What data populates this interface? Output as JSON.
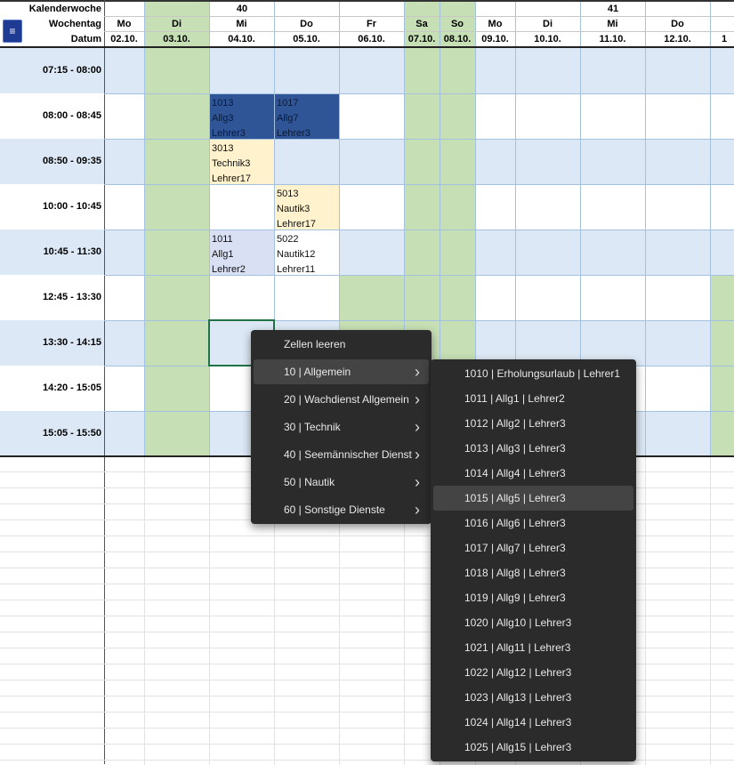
{
  "colors": {
    "timeslot_band": "#dce8f5",
    "weekend_fill": "#c6dfb4",
    "entry_dark": "#2f5597",
    "entry_cream": "#fff2cc",
    "entry_lavender": "#dae0f3",
    "grid_line": "#a4c2e0",
    "menu_bg": "#2b2b2b",
    "menu_highlight": "#444444",
    "menu_button": "#1f3a93"
  },
  "header": {
    "labels": {
      "week": "Kalenderwoche",
      "weekday": "Wochentag",
      "date": "Datum"
    },
    "weeks": [
      {
        "number": "40"
      },
      {
        "number": "41"
      }
    ],
    "menu_button_icon": "hamburger-menu-icon",
    "days": [
      {
        "weekday": "Mo",
        "date": "02.10."
      },
      {
        "weekday": "Di",
        "date": "03.10."
      },
      {
        "weekday": "Mi",
        "date": "04.10."
      },
      {
        "weekday": "Do",
        "date": "05.10."
      },
      {
        "weekday": "Fr",
        "date": "06.10."
      },
      {
        "weekday": "Sa",
        "date": "07.10."
      },
      {
        "weekday": "So",
        "date": "08.10."
      },
      {
        "weekday": "Mo",
        "date": "09.10."
      },
      {
        "weekday": "Di",
        "date": "10.10."
      },
      {
        "weekday": "Mi",
        "date": "11.10."
      },
      {
        "weekday": "Do",
        "date": "12.10."
      },
      {
        "weekday": "",
        "date": "1"
      }
    ]
  },
  "timeslots": [
    "07:15 - 08:00",
    "08:00 - 08:45",
    "08:50 - 09:35",
    "10:00 - 10:45",
    "10:45 - 11:30",
    "12:45 - 13:30",
    "13:30 - 14:15",
    "14:20 - 15:05",
    "15:05 - 15:50"
  ],
  "entries": [
    {
      "day": 2,
      "slot": 1,
      "style": "dark",
      "code": "1013",
      "subject": "Allg3",
      "teacher": "Lehrer3"
    },
    {
      "day": 3,
      "slot": 1,
      "style": "dark",
      "code": "1017",
      "subject": "Allg7",
      "teacher": "Lehrer3"
    },
    {
      "day": 2,
      "slot": 2,
      "style": "cream",
      "code": "3013",
      "subject": "Technik3",
      "teacher": "Lehrer17"
    },
    {
      "day": 3,
      "slot": 3,
      "style": "cream",
      "code": "5013",
      "subject": "Nautik3",
      "teacher": "Lehrer17"
    },
    {
      "day": 2,
      "slot": 4,
      "style": "lavender",
      "code": "1011",
      "subject": "Allg1",
      "teacher": "Lehrer2"
    },
    {
      "day": 3,
      "slot": 4,
      "style": "white",
      "code": "5022",
      "subject": "Nautik12",
      "teacher": "Lehrer11"
    }
  ],
  "context_menu": {
    "items": [
      {
        "label": "Zellen leeren",
        "submenu": false
      },
      {
        "label": "10 | Allgemein",
        "submenu": true,
        "active": true
      },
      {
        "label": "20 | Wachdienst Allgemein",
        "submenu": true
      },
      {
        "label": "30 | Technik",
        "submenu": true
      },
      {
        "label": "40 | Seemännischer Dienst",
        "submenu": true
      },
      {
        "label": "50 | Nautik",
        "submenu": true
      },
      {
        "label": "60 | Sonstige Dienste",
        "submenu": true
      }
    ],
    "submenu_items": [
      "1010 | Erholungsurlaub | Lehrer1",
      "1011 | Allg1 | Lehrer2",
      "1012 | Allg2 | Lehrer3",
      "1013 | Allg3 | Lehrer3",
      "1014 | Allg4 | Lehrer3",
      "1015 | Allg5 | Lehrer3",
      "1016 | Allg6 | Lehrer3",
      "1017 | Allg7 | Lehrer3",
      "1018 | Allg8 | Lehrer3",
      "1019 | Allg9 | Lehrer3",
      "1020 | Allg10 | Lehrer3",
      "1021 | Allg11 | Lehrer3",
      "1022 | Allg12 | Lehrer3",
      "1023 | Allg13 | Lehrer3",
      "1024 | Allg14 | Lehrer3",
      "1025 | Allg15 | Lehrer3"
    ],
    "submenu_highlight_index": 5,
    "chevron_icon": "chevron-right-icon"
  }
}
